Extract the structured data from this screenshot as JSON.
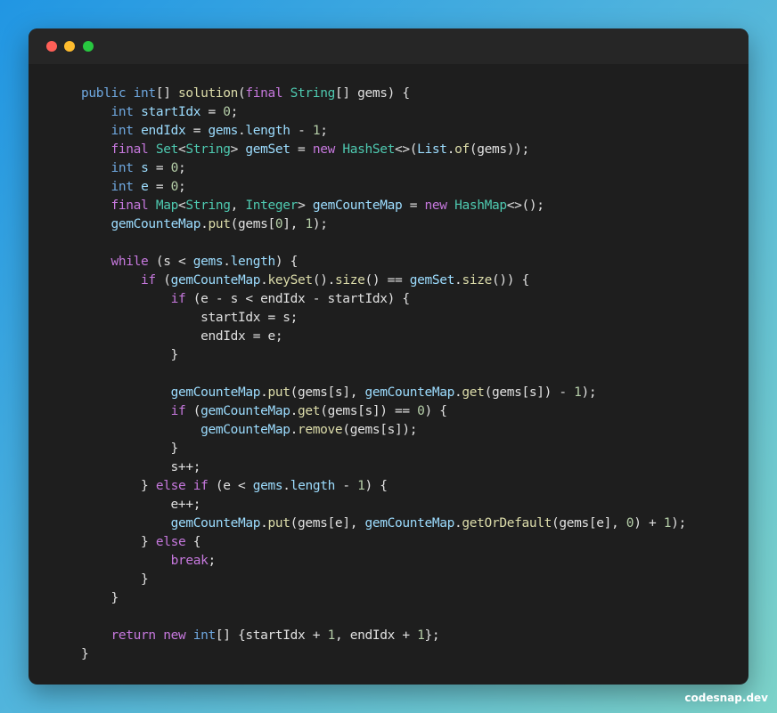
{
  "colors": {
    "default": "#e0e0e0",
    "keyword": "#c678dd",
    "storage": "#6fa8e0",
    "type": "#4ec9b0",
    "function": "#dcdcaa",
    "variable": "#9cdcfe",
    "number": "#b5cea8",
    "window_background": "#1e1e1e",
    "titlebar_background": "#262626"
  },
  "window": {
    "traffic_lights": [
      "close",
      "minimize",
      "maximize"
    ]
  },
  "code_lines": [
    [
      [
        "storage",
        "public "
      ],
      [
        "storage",
        "int"
      ],
      [
        "default",
        "[] "
      ],
      [
        "function",
        "solution"
      ],
      [
        "default",
        "("
      ],
      [
        "keyword",
        "final "
      ],
      [
        "type",
        "String"
      ],
      [
        "default",
        "[] gems) {"
      ]
    ],
    [
      [
        "default",
        "    "
      ],
      [
        "storage",
        "int "
      ],
      [
        "variable",
        "startIdx"
      ],
      [
        "default",
        " = "
      ],
      [
        "number",
        "0"
      ],
      [
        "default",
        ";"
      ]
    ],
    [
      [
        "default",
        "    "
      ],
      [
        "storage",
        "int "
      ],
      [
        "variable",
        "endIdx"
      ],
      [
        "default",
        " = "
      ],
      [
        "variable",
        "gems"
      ],
      [
        "default",
        "."
      ],
      [
        "variable",
        "length"
      ],
      [
        "default",
        " - "
      ],
      [
        "number",
        "1"
      ],
      [
        "default",
        ";"
      ]
    ],
    [
      [
        "default",
        "    "
      ],
      [
        "keyword",
        "final "
      ],
      [
        "type",
        "Set"
      ],
      [
        "default",
        "<"
      ],
      [
        "type",
        "String"
      ],
      [
        "default",
        "> "
      ],
      [
        "variable",
        "gemSet"
      ],
      [
        "default",
        " = "
      ],
      [
        "keyword",
        "new "
      ],
      [
        "type",
        "HashSet"
      ],
      [
        "default",
        "<>("
      ],
      [
        "variable",
        "List"
      ],
      [
        "default",
        "."
      ],
      [
        "function",
        "of"
      ],
      [
        "default",
        "(gems));"
      ]
    ],
    [
      [
        "default",
        "    "
      ],
      [
        "storage",
        "int "
      ],
      [
        "variable",
        "s"
      ],
      [
        "default",
        " = "
      ],
      [
        "number",
        "0"
      ],
      [
        "default",
        ";"
      ]
    ],
    [
      [
        "default",
        "    "
      ],
      [
        "storage",
        "int "
      ],
      [
        "variable",
        "e"
      ],
      [
        "default",
        " = "
      ],
      [
        "number",
        "0"
      ],
      [
        "default",
        ";"
      ]
    ],
    [
      [
        "default",
        "    "
      ],
      [
        "keyword",
        "final "
      ],
      [
        "type",
        "Map"
      ],
      [
        "default",
        "<"
      ],
      [
        "type",
        "String"
      ],
      [
        "default",
        ", "
      ],
      [
        "type",
        "Integer"
      ],
      [
        "default",
        "> "
      ],
      [
        "variable",
        "gemCounteMap"
      ],
      [
        "default",
        " = "
      ],
      [
        "keyword",
        "new "
      ],
      [
        "type",
        "HashMap"
      ],
      [
        "default",
        "<>();"
      ]
    ],
    [
      [
        "default",
        "    "
      ],
      [
        "variable",
        "gemCounteMap"
      ],
      [
        "default",
        "."
      ],
      [
        "function",
        "put"
      ],
      [
        "default",
        "(gems["
      ],
      [
        "number",
        "0"
      ],
      [
        "default",
        "], "
      ],
      [
        "number",
        "1"
      ],
      [
        "default",
        ");"
      ]
    ],
    [
      [
        "default",
        ""
      ]
    ],
    [
      [
        "default",
        "    "
      ],
      [
        "keyword",
        "while"
      ],
      [
        "default",
        " (s < "
      ],
      [
        "variable",
        "gems"
      ],
      [
        "default",
        "."
      ],
      [
        "variable",
        "length"
      ],
      [
        "default",
        ") {"
      ]
    ],
    [
      [
        "default",
        "        "
      ],
      [
        "keyword",
        "if"
      ],
      [
        "default",
        " ("
      ],
      [
        "variable",
        "gemCounteMap"
      ],
      [
        "default",
        "."
      ],
      [
        "function",
        "keySet"
      ],
      [
        "default",
        "()."
      ],
      [
        "function",
        "size"
      ],
      [
        "default",
        "() == "
      ],
      [
        "variable",
        "gemSet"
      ],
      [
        "default",
        "."
      ],
      [
        "function",
        "size"
      ],
      [
        "default",
        "()) {"
      ]
    ],
    [
      [
        "default",
        "            "
      ],
      [
        "keyword",
        "if"
      ],
      [
        "default",
        " (e - s < endIdx - startIdx) {"
      ]
    ],
    [
      [
        "default",
        "                startIdx = s;"
      ]
    ],
    [
      [
        "default",
        "                endIdx = e;"
      ]
    ],
    [
      [
        "default",
        "            }"
      ]
    ],
    [
      [
        "default",
        ""
      ]
    ],
    [
      [
        "default",
        "            "
      ],
      [
        "variable",
        "gemCounteMap"
      ],
      [
        "default",
        "."
      ],
      [
        "function",
        "put"
      ],
      [
        "default",
        "(gems[s], "
      ],
      [
        "variable",
        "gemCounteMap"
      ],
      [
        "default",
        "."
      ],
      [
        "function",
        "get"
      ],
      [
        "default",
        "(gems[s]) - "
      ],
      [
        "number",
        "1"
      ],
      [
        "default",
        ");"
      ]
    ],
    [
      [
        "default",
        "            "
      ],
      [
        "keyword",
        "if"
      ],
      [
        "default",
        " ("
      ],
      [
        "variable",
        "gemCounteMap"
      ],
      [
        "default",
        "."
      ],
      [
        "function",
        "get"
      ],
      [
        "default",
        "(gems[s]) == "
      ],
      [
        "number",
        "0"
      ],
      [
        "default",
        ") {"
      ]
    ],
    [
      [
        "default",
        "                "
      ],
      [
        "variable",
        "gemCounteMap"
      ],
      [
        "default",
        "."
      ],
      [
        "function",
        "remove"
      ],
      [
        "default",
        "(gems[s]);"
      ]
    ],
    [
      [
        "default",
        "            }"
      ]
    ],
    [
      [
        "default",
        "            s++;"
      ]
    ],
    [
      [
        "default",
        "        } "
      ],
      [
        "keyword",
        "else if"
      ],
      [
        "default",
        " (e < "
      ],
      [
        "variable",
        "gems"
      ],
      [
        "default",
        "."
      ],
      [
        "variable",
        "length"
      ],
      [
        "default",
        " - "
      ],
      [
        "number",
        "1"
      ],
      [
        "default",
        ") {"
      ]
    ],
    [
      [
        "default",
        "            e++;"
      ]
    ],
    [
      [
        "default",
        "            "
      ],
      [
        "variable",
        "gemCounteMap"
      ],
      [
        "default",
        "."
      ],
      [
        "function",
        "put"
      ],
      [
        "default",
        "(gems[e], "
      ],
      [
        "variable",
        "gemCounteMap"
      ],
      [
        "default",
        "."
      ],
      [
        "function",
        "getOrDefault"
      ],
      [
        "default",
        "(gems[e], "
      ],
      [
        "number",
        "0"
      ],
      [
        "default",
        ") + "
      ],
      [
        "number",
        "1"
      ],
      [
        "default",
        ");"
      ]
    ],
    [
      [
        "default",
        "        } "
      ],
      [
        "keyword",
        "else"
      ],
      [
        "default",
        " {"
      ]
    ],
    [
      [
        "default",
        "            "
      ],
      [
        "keyword",
        "break"
      ],
      [
        "default",
        ";"
      ]
    ],
    [
      [
        "default",
        "        }"
      ]
    ],
    [
      [
        "default",
        "    }"
      ]
    ],
    [
      [
        "default",
        ""
      ]
    ],
    [
      [
        "default",
        "    "
      ],
      [
        "keyword",
        "return "
      ],
      [
        "keyword",
        "new "
      ],
      [
        "storage",
        "int"
      ],
      [
        "default",
        "[] {startIdx + "
      ],
      [
        "number",
        "1"
      ],
      [
        "default",
        ", endIdx + "
      ],
      [
        "number",
        "1"
      ],
      [
        "default",
        "};"
      ]
    ],
    [
      [
        "default",
        "}"
      ]
    ]
  ],
  "watermark": "codesnap.dev"
}
